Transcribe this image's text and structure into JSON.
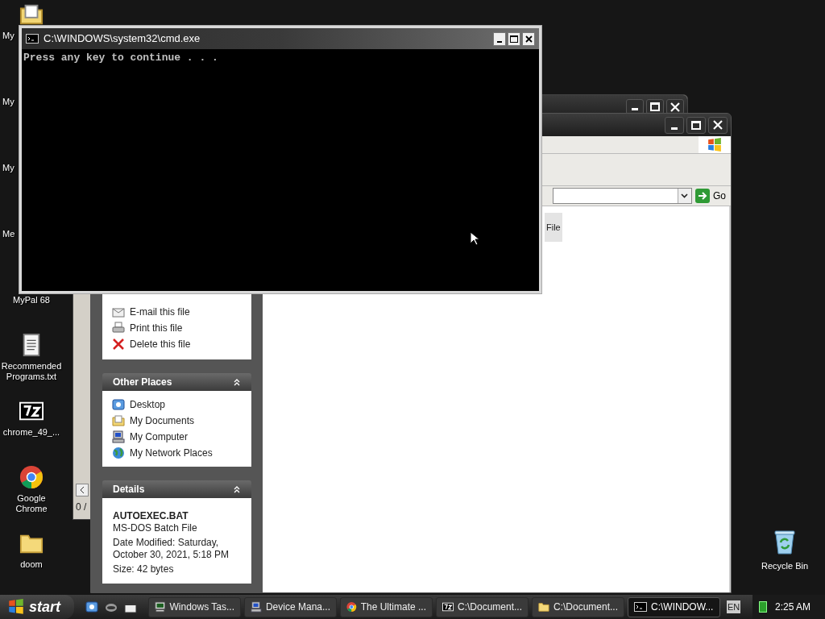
{
  "desktop_icons": [
    {
      "label": "My",
      "kind": "docs"
    },
    {
      "label": "My",
      "kind": "hidden"
    },
    {
      "label": "My",
      "kind": "hidden"
    },
    {
      "label": "Me",
      "kind": "hidden"
    },
    {
      "label": "MyPal 68",
      "kind": "hidden"
    },
    {
      "label": "Recommended Programs.txt",
      "kind": "notepad"
    },
    {
      "label": "chrome_49_...",
      "kind": "sevenzip"
    },
    {
      "label": "Google Chrome",
      "kind": "chrome"
    },
    {
      "label": "doom",
      "kind": "folder"
    }
  ],
  "recycle_bin": {
    "label": "Recycle Bin"
  },
  "back_window": {
    "status": "0 /"
  },
  "explorer": {
    "go_button": "Go",
    "toolbar_fragment": "File",
    "file_tasks": [
      "E-mail this file",
      "Print this file",
      "Delete this file"
    ],
    "other_places": {
      "title": "Other Places",
      "items": [
        {
          "label": "Desktop",
          "kind": "desktop"
        },
        {
          "label": "My Documents",
          "kind": "docs"
        },
        {
          "label": "My Computer",
          "kind": "computer"
        },
        {
          "label": "My Network Places",
          "kind": "network"
        }
      ]
    },
    "details": {
      "title": "Details",
      "name": "AUTOEXEC.BAT",
      "type": "MS-DOS Batch File",
      "modified": "Date Modified: Saturday, October 30, 2021, 5:18 PM",
      "size": "Size: 42 bytes"
    }
  },
  "cmd": {
    "title": "C:\\WINDOWS\\system32\\cmd.exe",
    "output": "Press any key to continue . . ."
  },
  "taskbar": {
    "start": "start",
    "tasks": [
      {
        "label": "Windows Tas...",
        "kind": "monitor",
        "selected": false
      },
      {
        "label": "Device Mana...",
        "kind": "computer",
        "selected": false
      },
      {
        "label": "The Ultimate ...",
        "kind": "chrome",
        "selected": false
      },
      {
        "label": "C:\\Document...",
        "kind": "sevenzip",
        "selected": false
      },
      {
        "label": "C:\\Document...",
        "kind": "folder",
        "selected": false
      },
      {
        "label": "C:\\WINDOW...",
        "kind": "cmd",
        "selected": true
      }
    ],
    "language": "EN",
    "clock": "2:25 AM"
  }
}
